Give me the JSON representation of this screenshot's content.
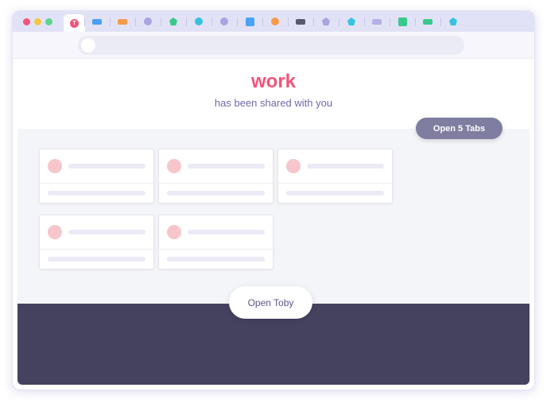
{
  "browser": {
    "window_dots": [
      "#f2547a",
      "#f7c542",
      "#5cd68d"
    ],
    "tab_logo_letter": "T",
    "tab_favicons": [
      {
        "icon": "rect-icon",
        "color": "#4a9ff5"
      },
      {
        "icon": "rect-icon",
        "color": "#f99a4a"
      },
      {
        "icon": "circle-icon",
        "color": "#a9a4e0"
      },
      {
        "icon": "pentagon-icon",
        "color": "#39c98b"
      },
      {
        "icon": "circle-icon",
        "color": "#36c2e0"
      },
      {
        "icon": "circle-icon",
        "color": "#a9a4e0"
      },
      {
        "icon": "square-icon",
        "color": "#4aa3f7"
      },
      {
        "icon": "circle-icon",
        "color": "#f99a4a"
      },
      {
        "icon": "rect-icon",
        "color": "#5a5870"
      },
      {
        "icon": "pentagon-icon",
        "color": "#a9a4e0"
      },
      {
        "icon": "pentagon-icon",
        "color": "#36c2e0"
      },
      {
        "icon": "rect-icon",
        "color": "#b5b0e6"
      },
      {
        "icon": "square-icon",
        "color": "#39c98b"
      },
      {
        "icon": "rect-icon",
        "color": "#39c98b"
      },
      {
        "icon": "pentagon-icon",
        "color": "#36c2e0"
      }
    ]
  },
  "share": {
    "collection_name": "work",
    "subtitle": "has been shared with you",
    "open_tabs_label": "Open 5 Tabs",
    "open_toby_label": "Open Toby"
  },
  "colors": {
    "accent": "#f2547a",
    "subtitle": "#6e6aa8",
    "footer": "#45425f",
    "button_grey": "#7f7da0"
  },
  "cards_count": 5
}
